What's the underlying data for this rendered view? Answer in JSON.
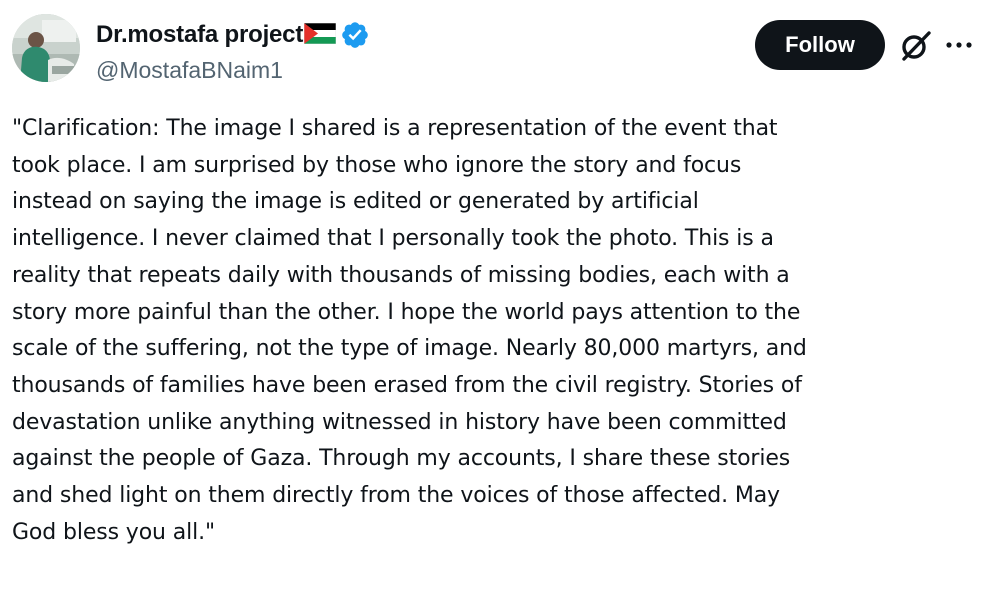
{
  "author": {
    "display_name": "Dr.mostafa project",
    "handle": "@MostafaBNaim1",
    "flag_icon": "palestine-flag-icon",
    "verified_icon": "verified-badge-icon",
    "verified_color": "#1d9bf0"
  },
  "actions": {
    "follow_label": "Follow",
    "grok_icon": "grok-icon",
    "more_icon": "more-horizontal-icon"
  },
  "post": {
    "lines": [
      "\"Clarification: The image I shared is a representation of the event that",
      "took place. I am surprised by those who ignore the story and focus",
      "instead on saying the image is edited or generated by artificial",
      "intelligence. I never claimed that I personally took the photo. This is a",
      "reality that repeats daily with thousands of missing bodies, each with a",
      "story more painful than the other. I hope the world pays attention to the",
      "scale of the suffering, not the type of image. Nearly 80,000 martyrs, and",
      "thousands of families have been erased from the civil registry. Stories of",
      "devastation unlike anything witnessed in history have been committed",
      "against the people of Gaza. Through my accounts, I share these stories",
      "and shed light on them directly from the voices of those affected. May",
      "God bless you all.\""
    ]
  },
  "colors": {
    "text_primary": "#0f1419",
    "text_secondary": "#536471",
    "follow_bg": "#0f1419",
    "follow_text": "#ffffff",
    "background": "#ffffff"
  }
}
